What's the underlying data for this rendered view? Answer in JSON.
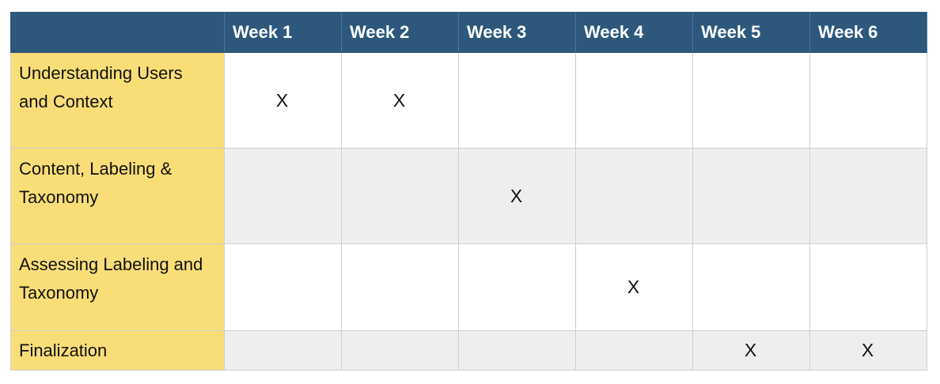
{
  "header": {
    "corner": "",
    "weeks": [
      "Week 1",
      "Week 2",
      "Week 3",
      "Week 4",
      "Week 5",
      "Week 6"
    ]
  },
  "rows": [
    {
      "label": "Understanding Users and Context",
      "cells": [
        "X",
        "X",
        "",
        "",
        "",
        ""
      ]
    },
    {
      "label": "Content, Labeling & Taxonomy",
      "cells": [
        "",
        "",
        "X",
        "",
        "",
        ""
      ]
    },
    {
      "label": "Assessing Labeling and Taxonomy",
      "cells": [
        "",
        "",
        "",
        "X",
        "",
        ""
      ]
    },
    {
      "label": "Finalization",
      "cells": [
        "",
        "",
        "",
        "",
        "X",
        "X"
      ]
    }
  ],
  "colors": {
    "header_bg": "#2d587c",
    "label_bg": "#f9de78",
    "alt_row_bg": "#eeeeee"
  }
}
